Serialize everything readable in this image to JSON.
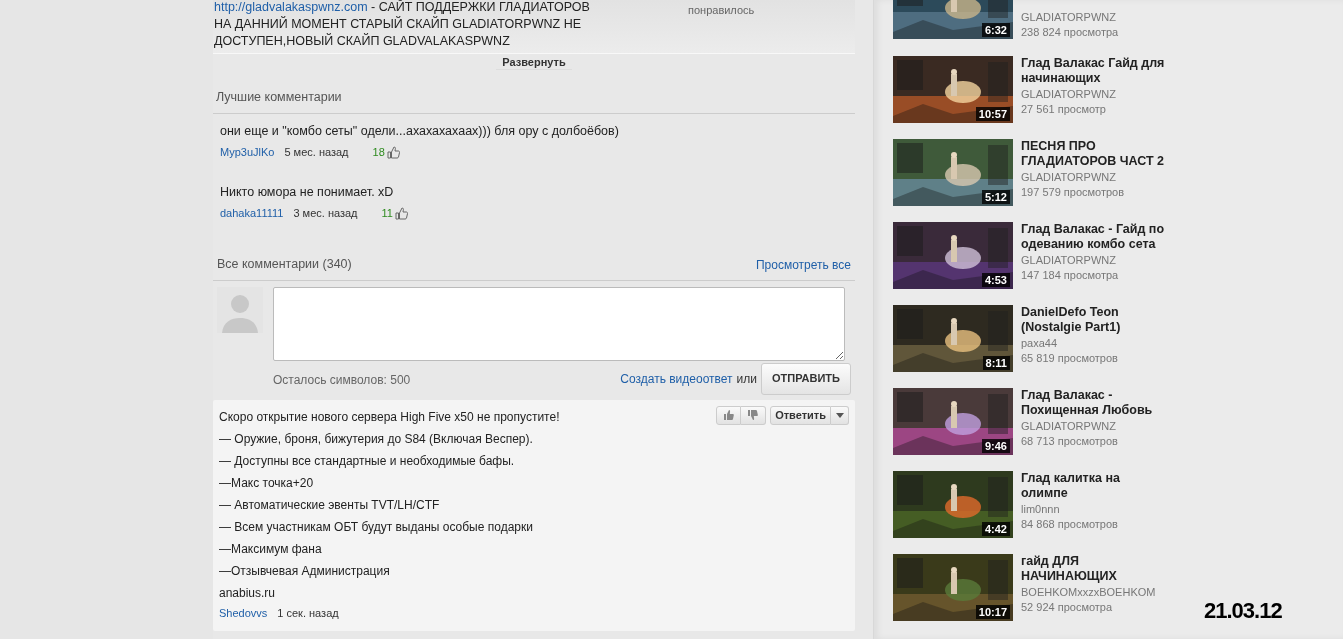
{
  "description": {
    "lines": [
      {
        "link": "http://gladvalakaspwnz.com",
        "text": " - САЙТ ПОДДЕРЖКИ ГЛАДИАТОРОВ"
      },
      {
        "text": "НА ДАННИЙ МОМЕНТ СТАРЫЙ СКАЙП GLADIATORPWNZ НЕ"
      },
      {
        "text": "ДОСТУПЕН,НОВЫЙ СКАЙП GLADVALAKASPWNZ"
      }
    ],
    "likes_label": "понравилось",
    "expand_button": "Развернуть"
  },
  "top_comments": {
    "title": "Лучшие комментарии",
    "comments": [
      {
        "text": "они еще и \"комбо сеты\" одели...ахахахахаах))) бля ору с долбоёбов)",
        "author": "Myp3uJlKo",
        "time": "5 мес. назад",
        "likes": "18"
      },
      {
        "text": "Никто юмора не понимает. xD",
        "author": "dahaka11111",
        "time": "3 мес. назад",
        "likes": "11"
      }
    ]
  },
  "all_comments": {
    "title": "Все комментарии (340)",
    "view_all": "Просмотреть все",
    "chars_left": "Осталось символов: 500",
    "video_reply": "Создать видеоответ",
    "or": "или",
    "send_button": "ОТПРАВИТЬ",
    "comments": [
      {
        "lines": [
          "Скоро открытие нового сервера High Five x50 не пропустите!",
          "— Оружие, броня, бижутерия до S84 (Включая Веспер).",
          "— Доступны все стандартные и необходимые бафы.",
          "—Макс точка+20",
          "— Автоматические эвенты TVT/LH/CTF",
          "— Всем участникам ОБТ будут выданы особые подарки",
          "—Максимум фана",
          "—Отзывчевая Администрация",
          "anabius.ru"
        ],
        "author": "Shedovvs",
        "time": "1 сек. назад",
        "reply_button": "Ответить"
      }
    ]
  },
  "related_videos": [
    {
      "channel": "GLADIATORPWNZ",
      "views": "238 824 просмотра",
      "duration": "6:32"
    },
    {
      "title": "Глад Валакас Гайд для начинающих",
      "channel": "GLADIATORPWNZ",
      "views": "27 561 просмотр",
      "duration": "10:57"
    },
    {
      "title": "ПЕСНЯ ПРО ГЛАДИАТОРОВ ЧАСТ 2",
      "channel": "GLADIATORPWNZ",
      "views": "197 579 просмотров",
      "duration": "5:12"
    },
    {
      "title": "Глад Валакас - Гайд по одеванию комбо сета",
      "channel": "GLADIATORPWNZ",
      "views": "147 184 просмотра",
      "duration": "4:53"
    },
    {
      "title": "DanielDefo Teon (Nostalgie Part1)",
      "channel": "paxa44",
      "views": "65 819 просмотров",
      "duration": "8:11"
    },
    {
      "title": "Глад Валакас - Похищенная Любовь",
      "channel": "GLADIATORPWNZ",
      "views": "68 713 просмотров",
      "duration": "9:46"
    },
    {
      "title": "Глад калитка на олимпе",
      "channel": "lim0nnn",
      "views": "84 868 просмотров",
      "duration": "4:42"
    },
    {
      "title": "гайд ДЛЯ НАЧИНАЮЩИХ",
      "channel": "BOEHKOMxxzxBOEHKOM",
      "views": "52 924 просмотра",
      "duration": "10:17"
    }
  ],
  "date_stamp": "21.03.12"
}
